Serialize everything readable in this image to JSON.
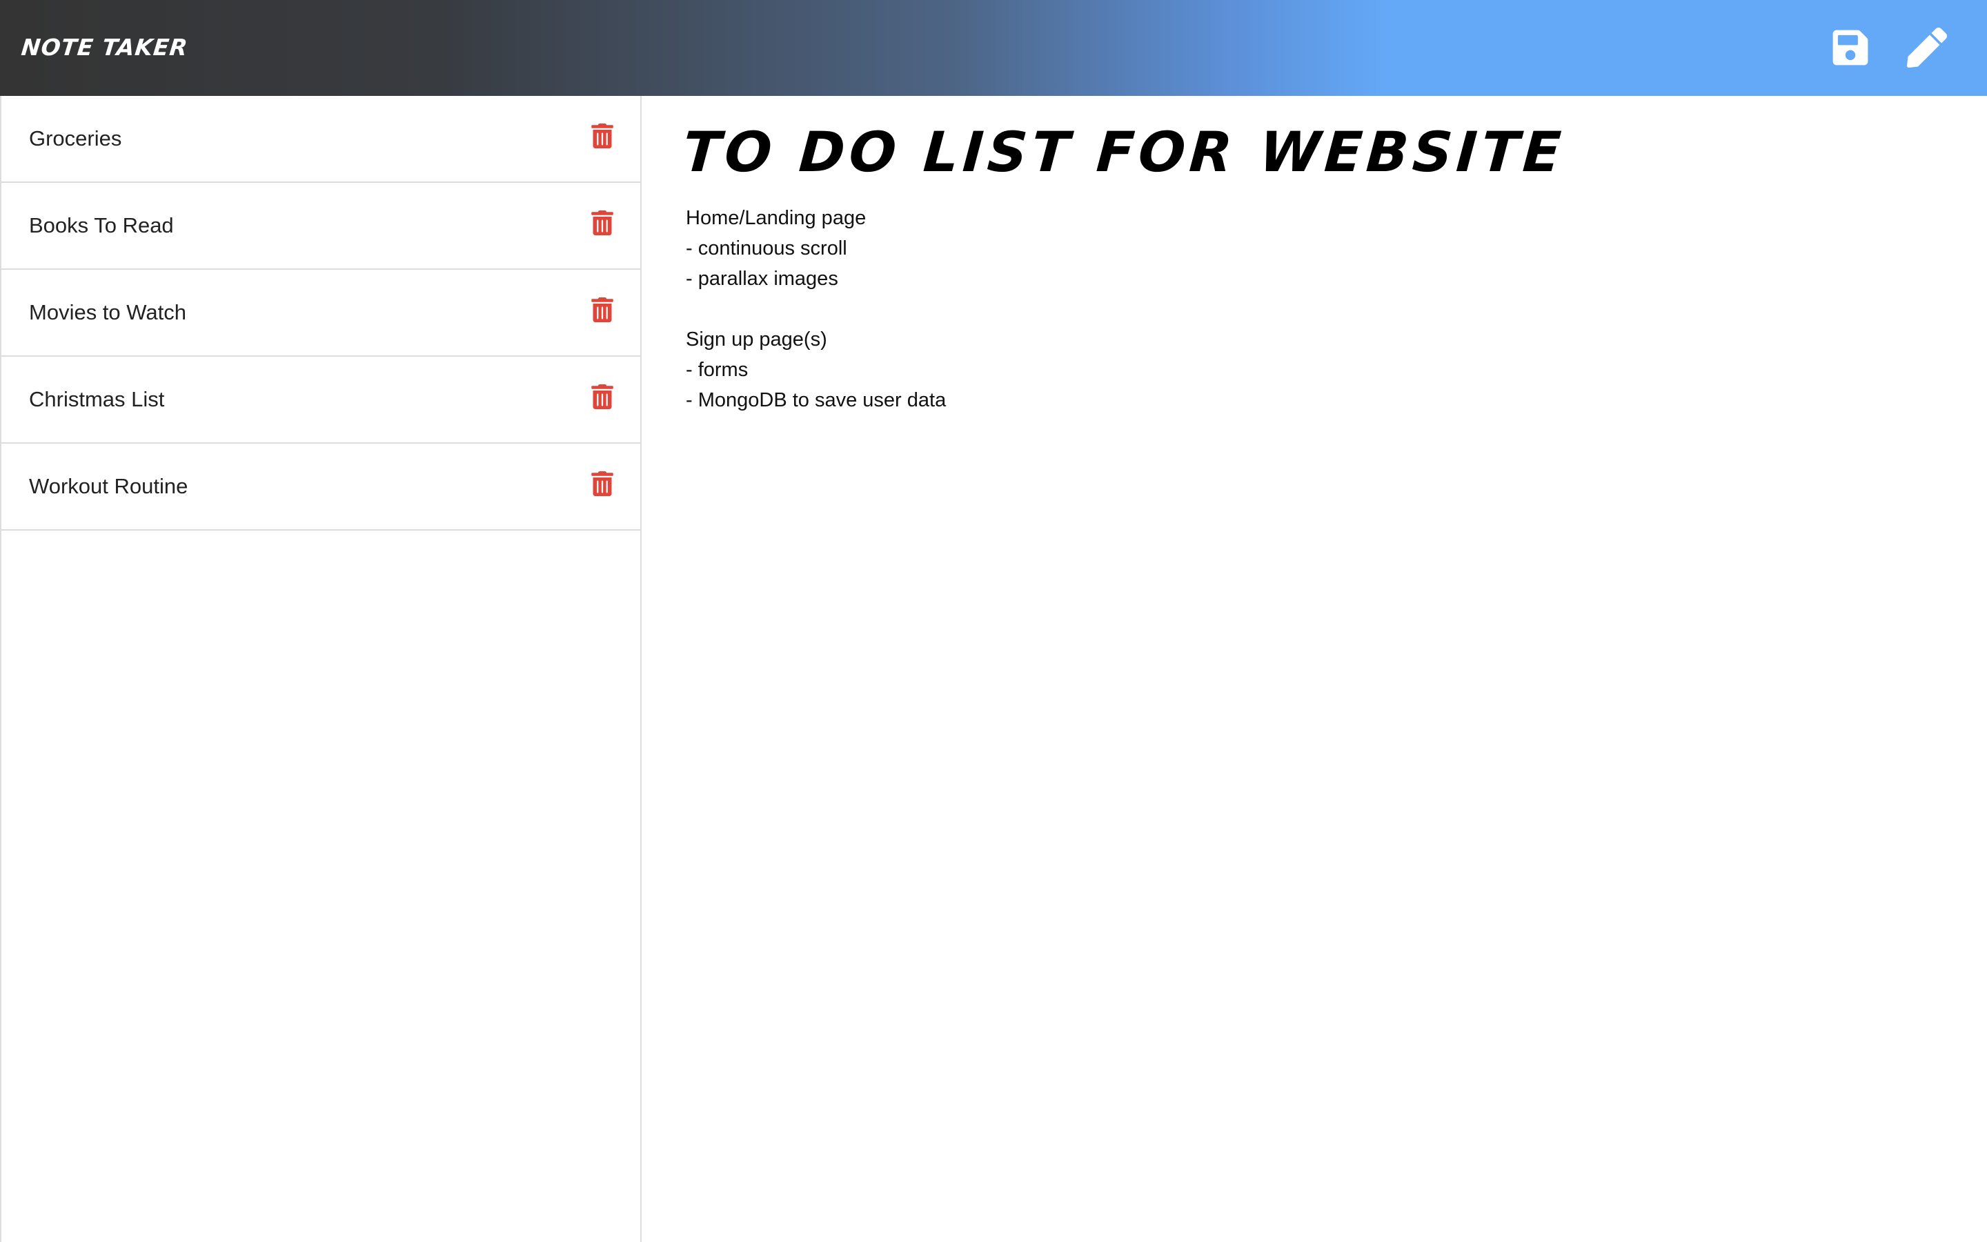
{
  "app": {
    "brand": "Note Taker"
  },
  "toolbar": {
    "save_icon": "floppy-disk-icon",
    "edit_icon": "pencil-icon"
  },
  "colors": {
    "nav_dark": "#343434",
    "nav_blue": "#64a9f8",
    "delete_red": "#e0453a",
    "icon_white": "#ffffff"
  },
  "sidebar": {
    "items": [
      {
        "title": "Groceries",
        "icon": "trash-icon"
      },
      {
        "title": "Books To Read",
        "icon": "trash-icon"
      },
      {
        "title": "Movies to Watch",
        "icon": "trash-icon"
      },
      {
        "title": "Christmas List",
        "icon": "trash-icon"
      },
      {
        "title": "Workout Routine",
        "icon": "trash-icon"
      }
    ]
  },
  "note": {
    "title": "To Do List for Website",
    "body": "Home/Landing page\n- continuous scroll\n- parallax images\n\nSign up page(s)\n- forms\n- MongoDB to save user data"
  }
}
